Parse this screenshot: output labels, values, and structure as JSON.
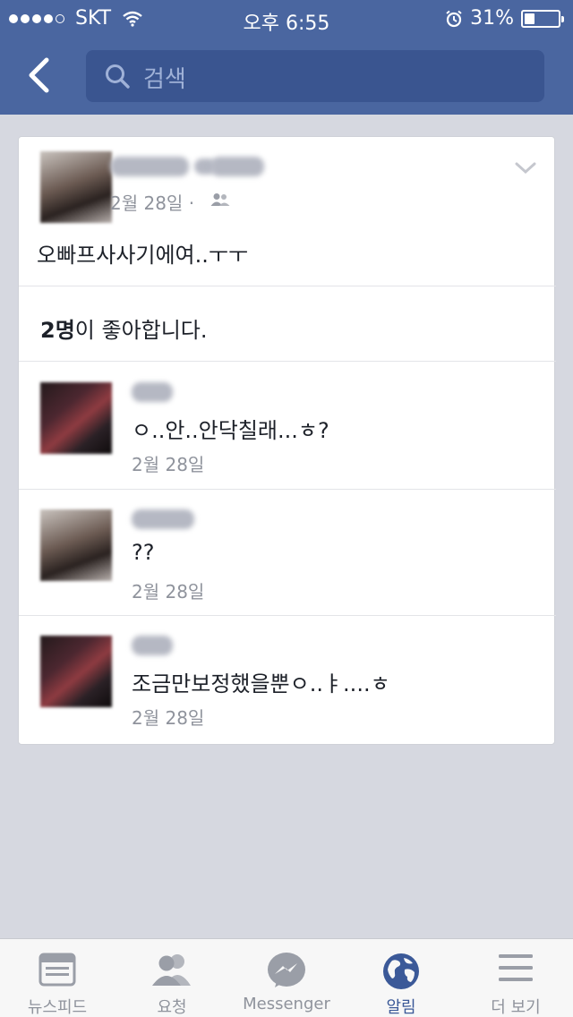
{
  "status_bar": {
    "carrier": "SKT",
    "time": "오후 6:55",
    "battery": "31%",
    "battery_level": 0.31
  },
  "header": {
    "search_placeholder": "검색"
  },
  "post": {
    "date": "2월 28일",
    "separator": "·",
    "text": "오빠프사사기에여..ㅜㅜ"
  },
  "likes": {
    "count": "2명",
    "suffix": "이 좋아합니다."
  },
  "comments": [
    {
      "text": "ㅇ..안..안닥칠래...ㅎ?",
      "date": "2월 28일"
    },
    {
      "text": "??",
      "date": "2월 28일"
    },
    {
      "text": "조금만보정했을뿐ㅇ..ㅑ....ㅎ",
      "date": "2월 28일"
    }
  ],
  "tabs": [
    {
      "label": "뉴스피드",
      "icon": "newsfeed-icon"
    },
    {
      "label": "요청",
      "icon": "friend-requests-icon"
    },
    {
      "label": "Messenger",
      "icon": "messenger-icon"
    },
    {
      "label": "알림",
      "icon": "globe-icon",
      "active": true
    },
    {
      "label": "더 보기",
      "icon": "menu-icon"
    }
  ],
  "colors": {
    "header": "#4a66a0",
    "accent": "#3b5998"
  }
}
